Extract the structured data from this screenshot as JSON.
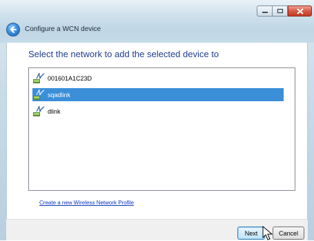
{
  "window": {
    "title": "Configure a WCN device",
    "controls": [
      "minimize-icon",
      "maximize-icon",
      "close-icon"
    ]
  },
  "main": {
    "heading": "Select the network to add the selected device to",
    "networks": [
      {
        "name": "001601A1C23D",
        "selected": false,
        "icon": "wireless-network-icon"
      },
      {
        "name": "sqadlink",
        "selected": true,
        "icon": "wireless-network-icon"
      },
      {
        "name": "dlink",
        "selected": false,
        "icon": "wireless-network-icon"
      }
    ],
    "create_link": "Create a new Wireless Network Profile"
  },
  "footer": {
    "next_label": "Next",
    "cancel_label": "Cancel"
  },
  "colors": {
    "heading": "#1f3d8f",
    "selection": "#3b8ed8",
    "link": "#0a36c0"
  }
}
